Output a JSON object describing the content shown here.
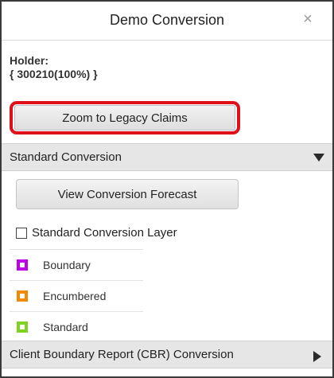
{
  "header": {
    "title": "Demo Conversion",
    "close_glyph": "×"
  },
  "holder": {
    "label": "Holder:",
    "value": "{ 300210(100%) }"
  },
  "zoom_button": {
    "label": "Zoom to Legacy Claims",
    "highlight_color": "#e0101b"
  },
  "standard_section": {
    "title": "Standard Conversion",
    "expanded": true,
    "forecast_button_label": "View Conversion Forecast",
    "layer_toggle": {
      "label": "Standard Conversion Layer",
      "checked": false
    },
    "legend": [
      {
        "label": "Boundary",
        "color": "#c000e8"
      },
      {
        "label": "Encumbered",
        "color": "#f08a00"
      },
      {
        "label": "Standard",
        "color": "#7ed321"
      }
    ]
  },
  "cbr_section": {
    "title": "Client Boundary Report (CBR) Conversion",
    "expanded": false
  }
}
